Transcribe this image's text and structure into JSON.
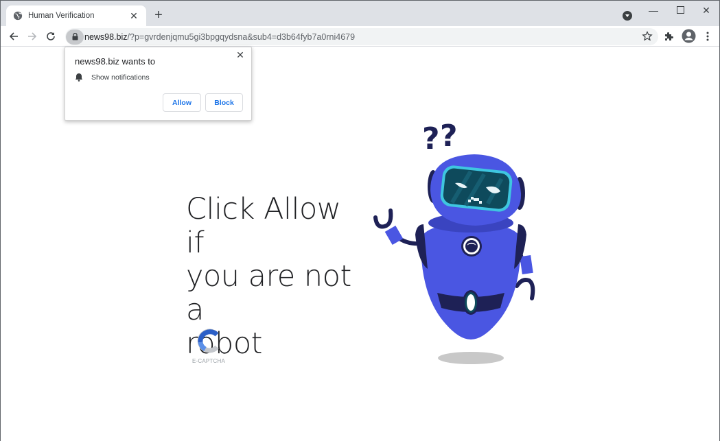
{
  "browser": {
    "tab": {
      "title": "Human Verification",
      "favicon": "globe-icon"
    },
    "new_tab_label": "+",
    "window_controls": {
      "minimize": "minimize-icon",
      "maximize": "maximize-icon",
      "close": "close-icon"
    },
    "toolbar": {
      "back": "back-arrow-icon",
      "forward": "forward-arrow-icon",
      "reload": "reload-icon",
      "url_host": "news98.biz",
      "url_rest": "/?p=gvrdenjqmu5gi3bpgqydsna&sub4=d3b64fyb7a0rni4679",
      "bookmark": "star-icon",
      "extensions": "puzzle-icon",
      "profile": "account-icon",
      "menu": "kebab-menu-icon"
    }
  },
  "permission_popup": {
    "title": "news98.biz wants to",
    "permission_icon": "bell-icon",
    "permission_text": "Show notifications",
    "allow_label": "Allow",
    "block_label": "Block",
    "close": "close-icon"
  },
  "page": {
    "headline_lines": [
      "Click Allow if",
      "you are not a",
      "robot"
    ],
    "captcha_label": "E-CAPTCHA",
    "colors": {
      "robot_body": "#4a56e2",
      "robot_dark": "#1e2156",
      "visor": "#0e4a5c",
      "visor_rim": "#3ec6e0",
      "captcha_blue_dark": "#2b5fc7",
      "captcha_blue_light": "#5b8fe8",
      "captcha_gray": "#c4c7cc"
    }
  }
}
